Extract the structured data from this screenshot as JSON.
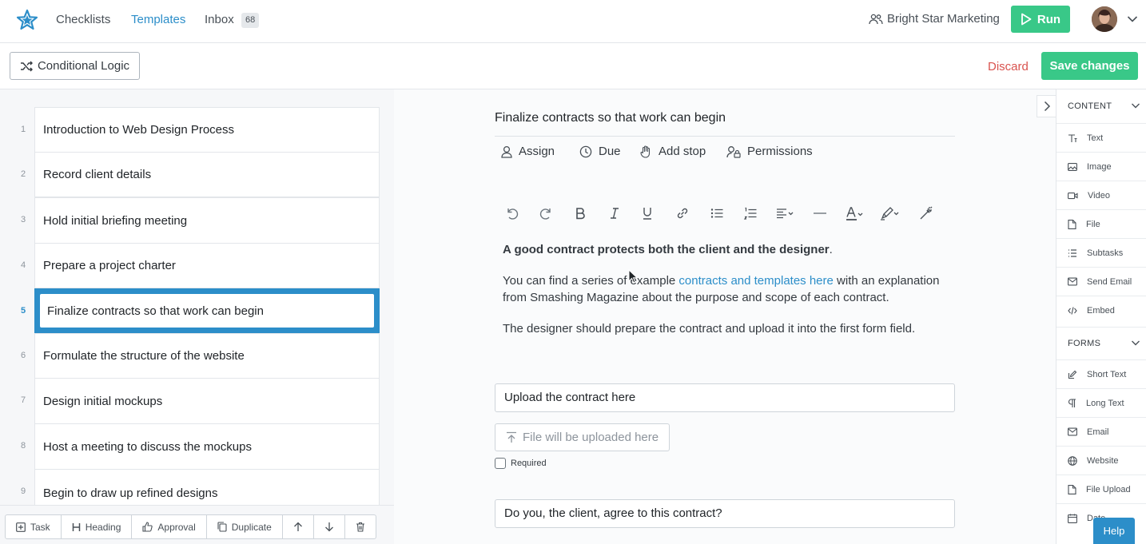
{
  "nav": {
    "links": [
      "Checklists",
      "Templates",
      "Inbox"
    ],
    "inbox_count": "68",
    "org_name": "Bright Star Marketing",
    "run_label": "Run"
  },
  "toolbar": {
    "conditional_logic_label": "Conditional Logic",
    "discard_label": "Discard",
    "save_label": "Save changes"
  },
  "tasks": [
    {
      "num": "1",
      "label": "Introduction to Web Design Process"
    },
    {
      "num": "2",
      "label": "Record client details"
    },
    {
      "num": "3",
      "label": "Hold initial briefing meeting"
    },
    {
      "num": "4",
      "label": "Prepare a project charter"
    },
    {
      "num": "5",
      "label": "Finalize contracts so that work can begin",
      "selected": true
    },
    {
      "num": "6",
      "label": "Formulate the structure of the website"
    },
    {
      "num": "7",
      "label": "Design initial mockups"
    },
    {
      "num": "8",
      "label": "Host a meeting to discuss the mockups"
    },
    {
      "num": "9",
      "label": "Begin to draw up refined designs"
    }
  ],
  "bottom_bar": [
    "Task",
    "Heading",
    "Approval",
    "Duplicate"
  ],
  "editor": {
    "title": "Finalize contracts so that work can begin",
    "meta": [
      "Assign",
      "Due",
      "Add stop",
      "Permissions"
    ],
    "para1_bold": "A good contract protects both the client and the designer",
    "para1_tail": ".",
    "para2_pre": "You can find a series of example ",
    "para2_link": "contracts and templates here",
    "para2_post": " with an explanation from Smashing Magazine about the purpose and scope of each contract.",
    "para3": "The designer should prepare the contract and upload it into the first form field.",
    "field1_label": "Upload the contract here",
    "upload_placeholder": "File will be uploaded here",
    "required_label": "Required",
    "field2_label": "Do you, the client, agree to this contract?"
  },
  "palette": {
    "content_head": "CONTENT",
    "content_items": [
      "Text",
      "Image",
      "Video",
      "File",
      "Subtasks",
      "Send Email",
      "Embed"
    ],
    "forms_head": "FORMS",
    "forms_items": [
      "Short Text",
      "Long Text",
      "Email",
      "Website",
      "File Upload",
      "Date"
    ]
  },
  "help_label": "Help",
  "colors": {
    "accent": "#2c8ec9",
    "success": "#39c888",
    "danger": "#d9534f"
  }
}
